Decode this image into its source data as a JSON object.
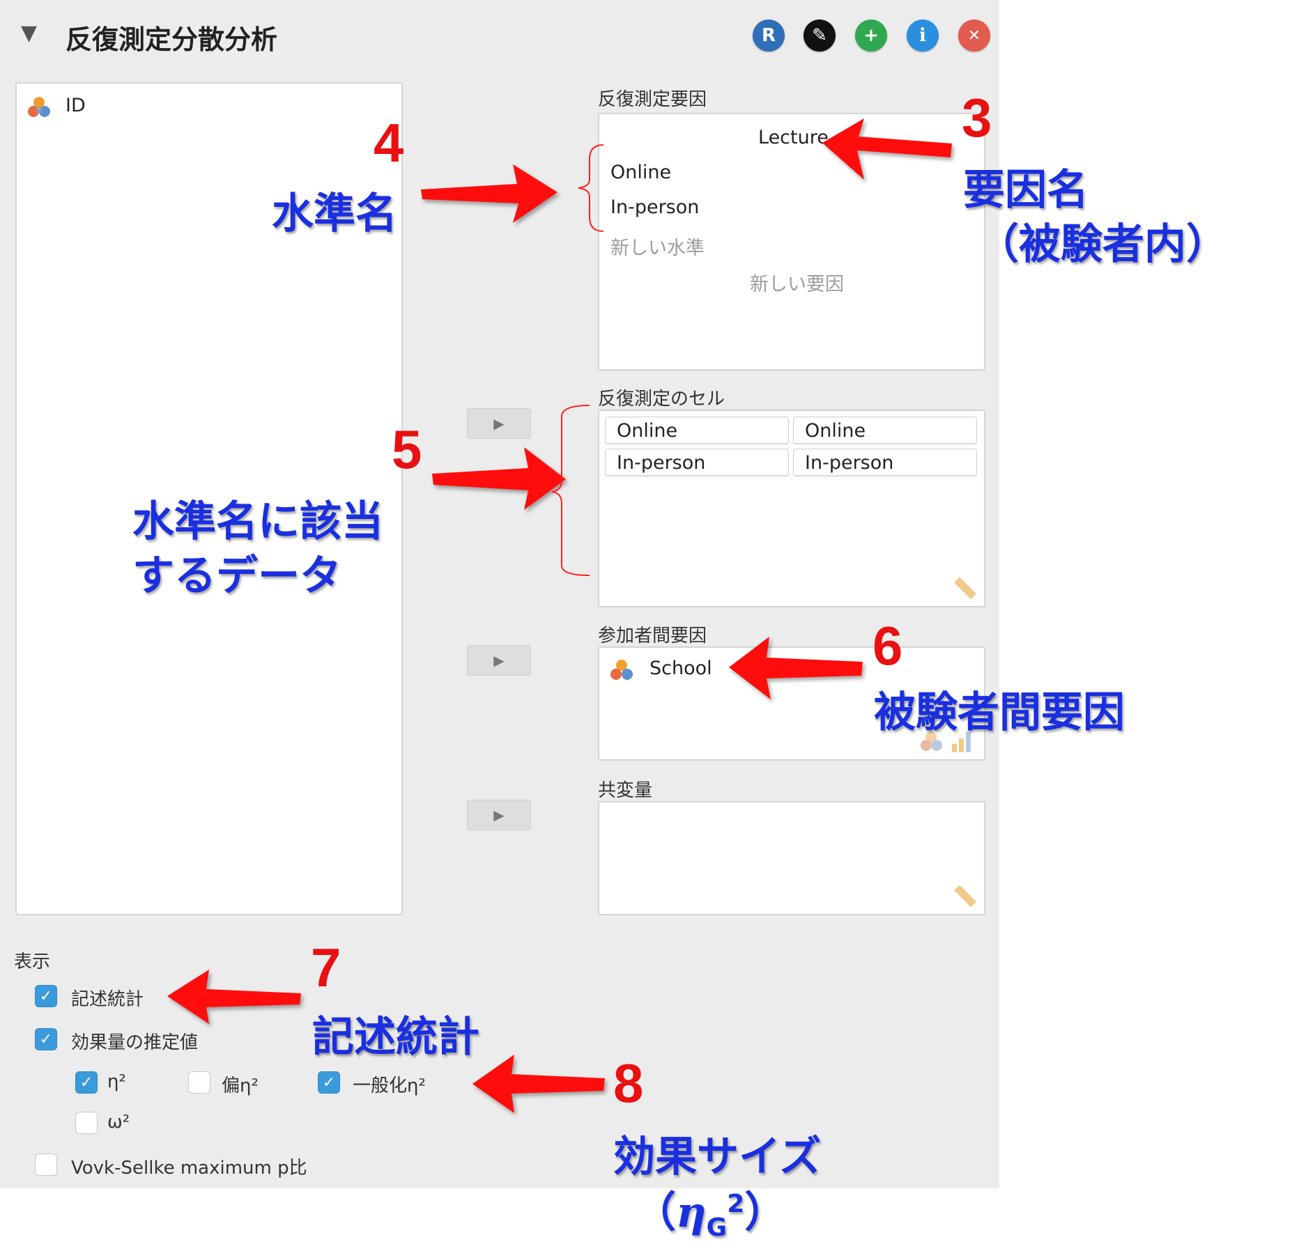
{
  "header": {
    "collapse_glyph": "▼",
    "title": "反復測定分散分析",
    "buttons": [
      {
        "name": "r-button",
        "label": "R",
        "color": "#2e6fb8"
      },
      {
        "name": "edit-button",
        "label": "✎",
        "color": "#111111"
      },
      {
        "name": "add-button",
        "label": "+",
        "color": "#2fa84f"
      },
      {
        "name": "info-button",
        "label": "i",
        "color": "#2b8fe0"
      },
      {
        "name": "close-button",
        "label": "✕",
        "color": "#e25b4f"
      }
    ]
  },
  "variables": {
    "items": [
      "ID"
    ]
  },
  "rm_factors": {
    "label": "反復測定要因",
    "factor_name": "Lecture",
    "levels": [
      "Online",
      "In-person"
    ],
    "new_level_placeholder": "新しい水準",
    "new_factor_placeholder": "新しい要因"
  },
  "rm_cells": {
    "label": "反復測定のセル",
    "rows": [
      [
        "Online",
        "Online"
      ],
      [
        "In-person",
        "In-person"
      ]
    ]
  },
  "between_factors": {
    "label": "参加者間要因",
    "items": [
      "School"
    ]
  },
  "covariates": {
    "label": "共変量"
  },
  "display": {
    "label": "表示",
    "descriptives": {
      "label": "記述統計",
      "checked": true
    },
    "effect_size": {
      "label": "効果量の推定値",
      "checked": true
    },
    "eta2": {
      "label": "η²",
      "checked": true
    },
    "partial_eta2": {
      "label": "偏η²",
      "checked": false
    },
    "general_eta2": {
      "label": "一般化η²",
      "checked": true
    },
    "omega2": {
      "label": "ω²",
      "checked": false
    },
    "vovk_sellke": {
      "label": "Vovk-Sellke maximum p比",
      "checked": false
    }
  },
  "annotations": {
    "n3": "3",
    "t3a": "要因名",
    "t3b": "（被験者内）",
    "n4": "4",
    "t4": "水準名",
    "n5": "5",
    "t5a": "水準名に該当",
    "t5b": "するデータ",
    "n6": "6",
    "t6": "被験者間要因",
    "n7": "7",
    "t7": "記述統計",
    "n8": "8",
    "t8a": "効果サイズ",
    "t8b_open": "（",
    "t8b_eta": "η",
    "t8b_sub": "G",
    "t8b_sup": "2",
    "t8b_close": "）"
  },
  "colors": {
    "panel_bg": "#ececec",
    "checkbox_on": "#3a9bdc",
    "annotation_red": "#e81010",
    "annotation_blue": "#1a2fe0"
  }
}
